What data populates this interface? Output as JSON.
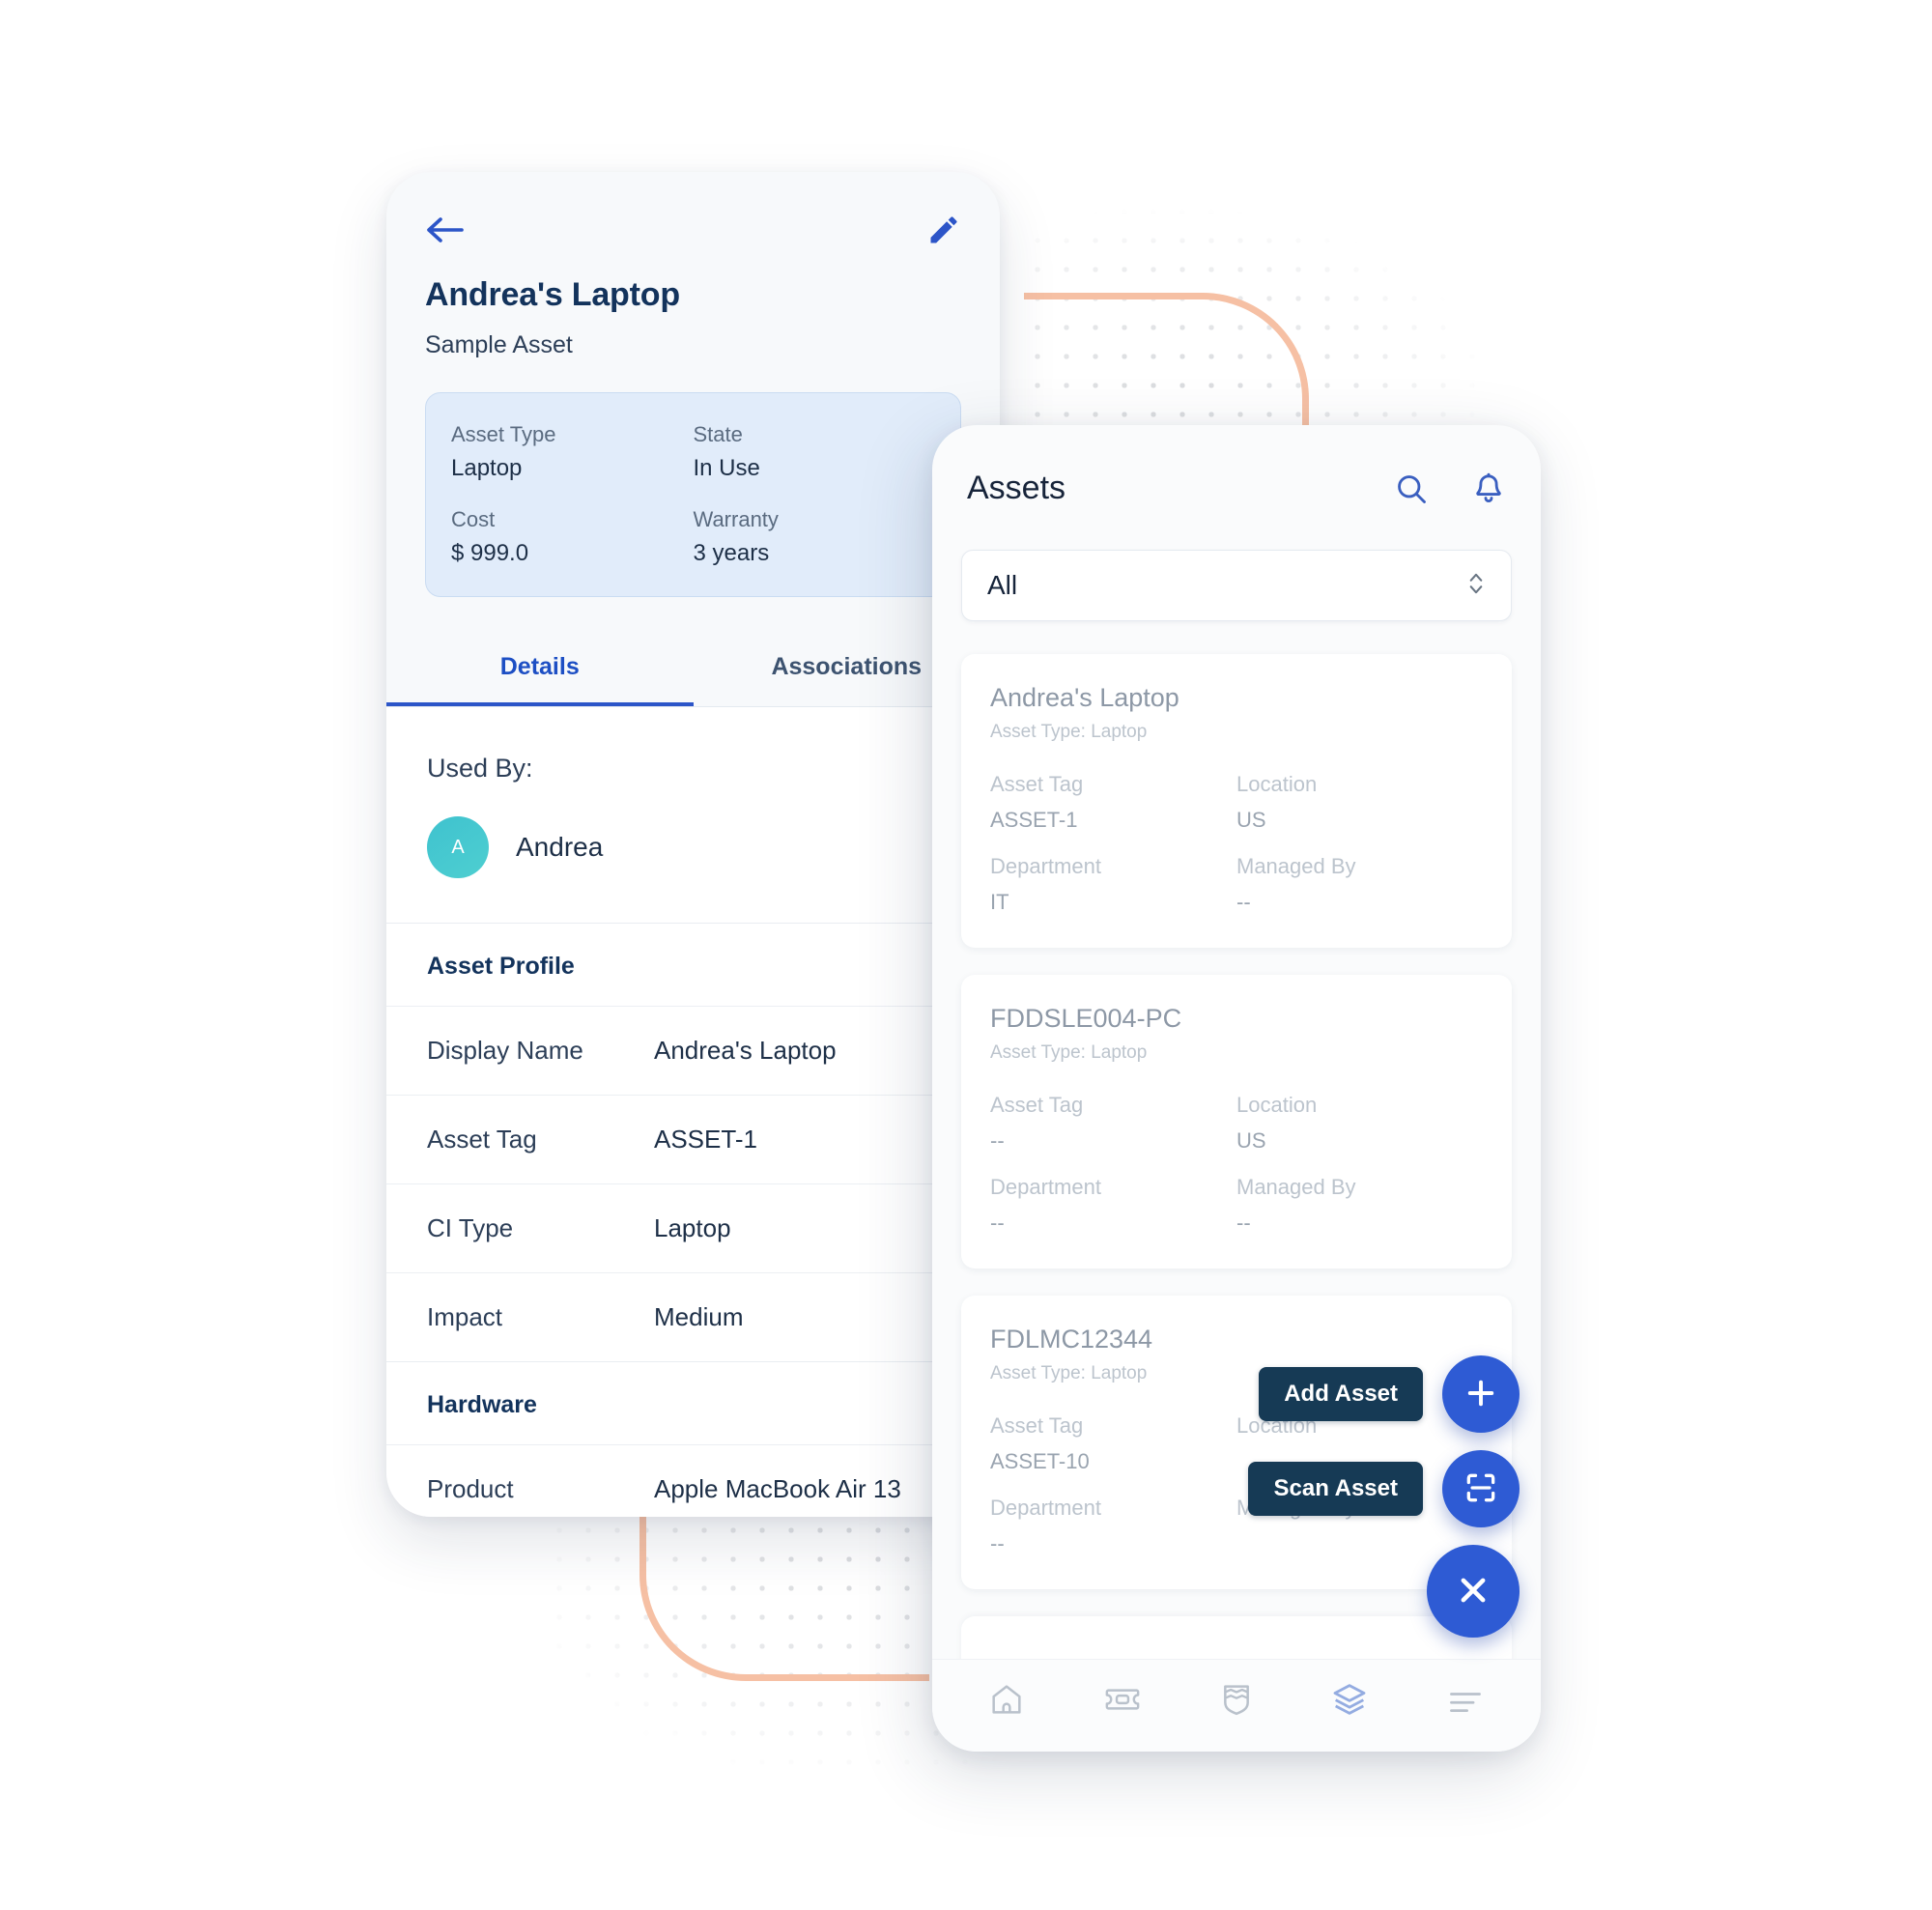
{
  "colors": {
    "accent_blue": "#2e5bd4",
    "title_navy": "#13335c",
    "tooltip_navy": "#163a55",
    "info_card_bg": "#e1ecfa",
    "avatar_teal": "#4ecfd0",
    "deco_peach": "#f6c0a4",
    "muted_grey": "#9aa4b0"
  },
  "detail_screen": {
    "back_icon": "arrow-left-icon",
    "edit_icon": "pencil-icon",
    "title": "Andrea's Laptop",
    "subtitle": "Sample Asset",
    "info_card": [
      {
        "label": "Asset Type",
        "value": "Laptop"
      },
      {
        "label": "State",
        "value": "In Use"
      },
      {
        "label": "Cost",
        "value": "$ 999.0"
      },
      {
        "label": "Warranty",
        "value": "3 years"
      }
    ],
    "tabs": [
      {
        "label": "Details",
        "active": true
      },
      {
        "label": "Associations",
        "active": false
      }
    ],
    "used_by": {
      "label": "Used By:",
      "avatar_initial": "A",
      "name": "Andrea"
    },
    "sections": [
      {
        "heading": "Asset Profile",
        "fields": [
          {
            "label": "Display Name",
            "value": "Andrea's Laptop"
          },
          {
            "label": "Asset Tag",
            "value": "ASSET-1"
          },
          {
            "label": "CI Type",
            "value": "Laptop"
          },
          {
            "label": "Impact",
            "value": "Medium"
          }
        ]
      },
      {
        "heading": "Hardware",
        "fields": [
          {
            "label": "Product",
            "value": "Apple MacBook Air 13"
          }
        ]
      }
    ]
  },
  "list_screen": {
    "title": "Assets",
    "search_icon": "search-icon",
    "bell_icon": "bell-icon",
    "filter": {
      "value": "All",
      "chevron_icon": "chevron-up-down-icon"
    },
    "cards": [
      {
        "title": "Andrea's Laptop",
        "subtitle": "Asset Type: Laptop",
        "fields": [
          {
            "label": "Asset Tag",
            "value": "ASSET-1"
          },
          {
            "label": "Location",
            "value": "US"
          },
          {
            "label": "Department",
            "value": "IT"
          },
          {
            "label": "Managed By",
            "value": "--"
          }
        ]
      },
      {
        "title": "FDDSLE004-PC",
        "subtitle": "Asset Type: Laptop",
        "fields": [
          {
            "label": "Asset Tag",
            "value": "--"
          },
          {
            "label": "Location",
            "value": "US"
          },
          {
            "label": "Department",
            "value": "--"
          },
          {
            "label": "Managed By",
            "value": "--"
          }
        ]
      },
      {
        "title": "FDLMC12344",
        "subtitle": "Asset Type: Laptop",
        "fields": [
          {
            "label": "Asset Tag",
            "value": "ASSET-10"
          },
          {
            "label": "Location",
            "value": ""
          },
          {
            "label": "Department",
            "value": "--"
          },
          {
            "label": "Managed By",
            "value": ""
          }
        ]
      }
    ],
    "fab_actions": [
      {
        "label": "Add Asset",
        "icon": "plus-icon"
      },
      {
        "label": "Scan Asset",
        "icon": "scan-barcode-icon"
      }
    ],
    "fab_close_icon": "close-icon",
    "bottom_nav": [
      {
        "icon": "home-icon",
        "active": false
      },
      {
        "icon": "ticket-icon",
        "active": false
      },
      {
        "icon": "shield-icon",
        "active": false
      },
      {
        "icon": "layers-icon",
        "active": true
      },
      {
        "icon": "menu-icon",
        "active": false
      }
    ]
  }
}
